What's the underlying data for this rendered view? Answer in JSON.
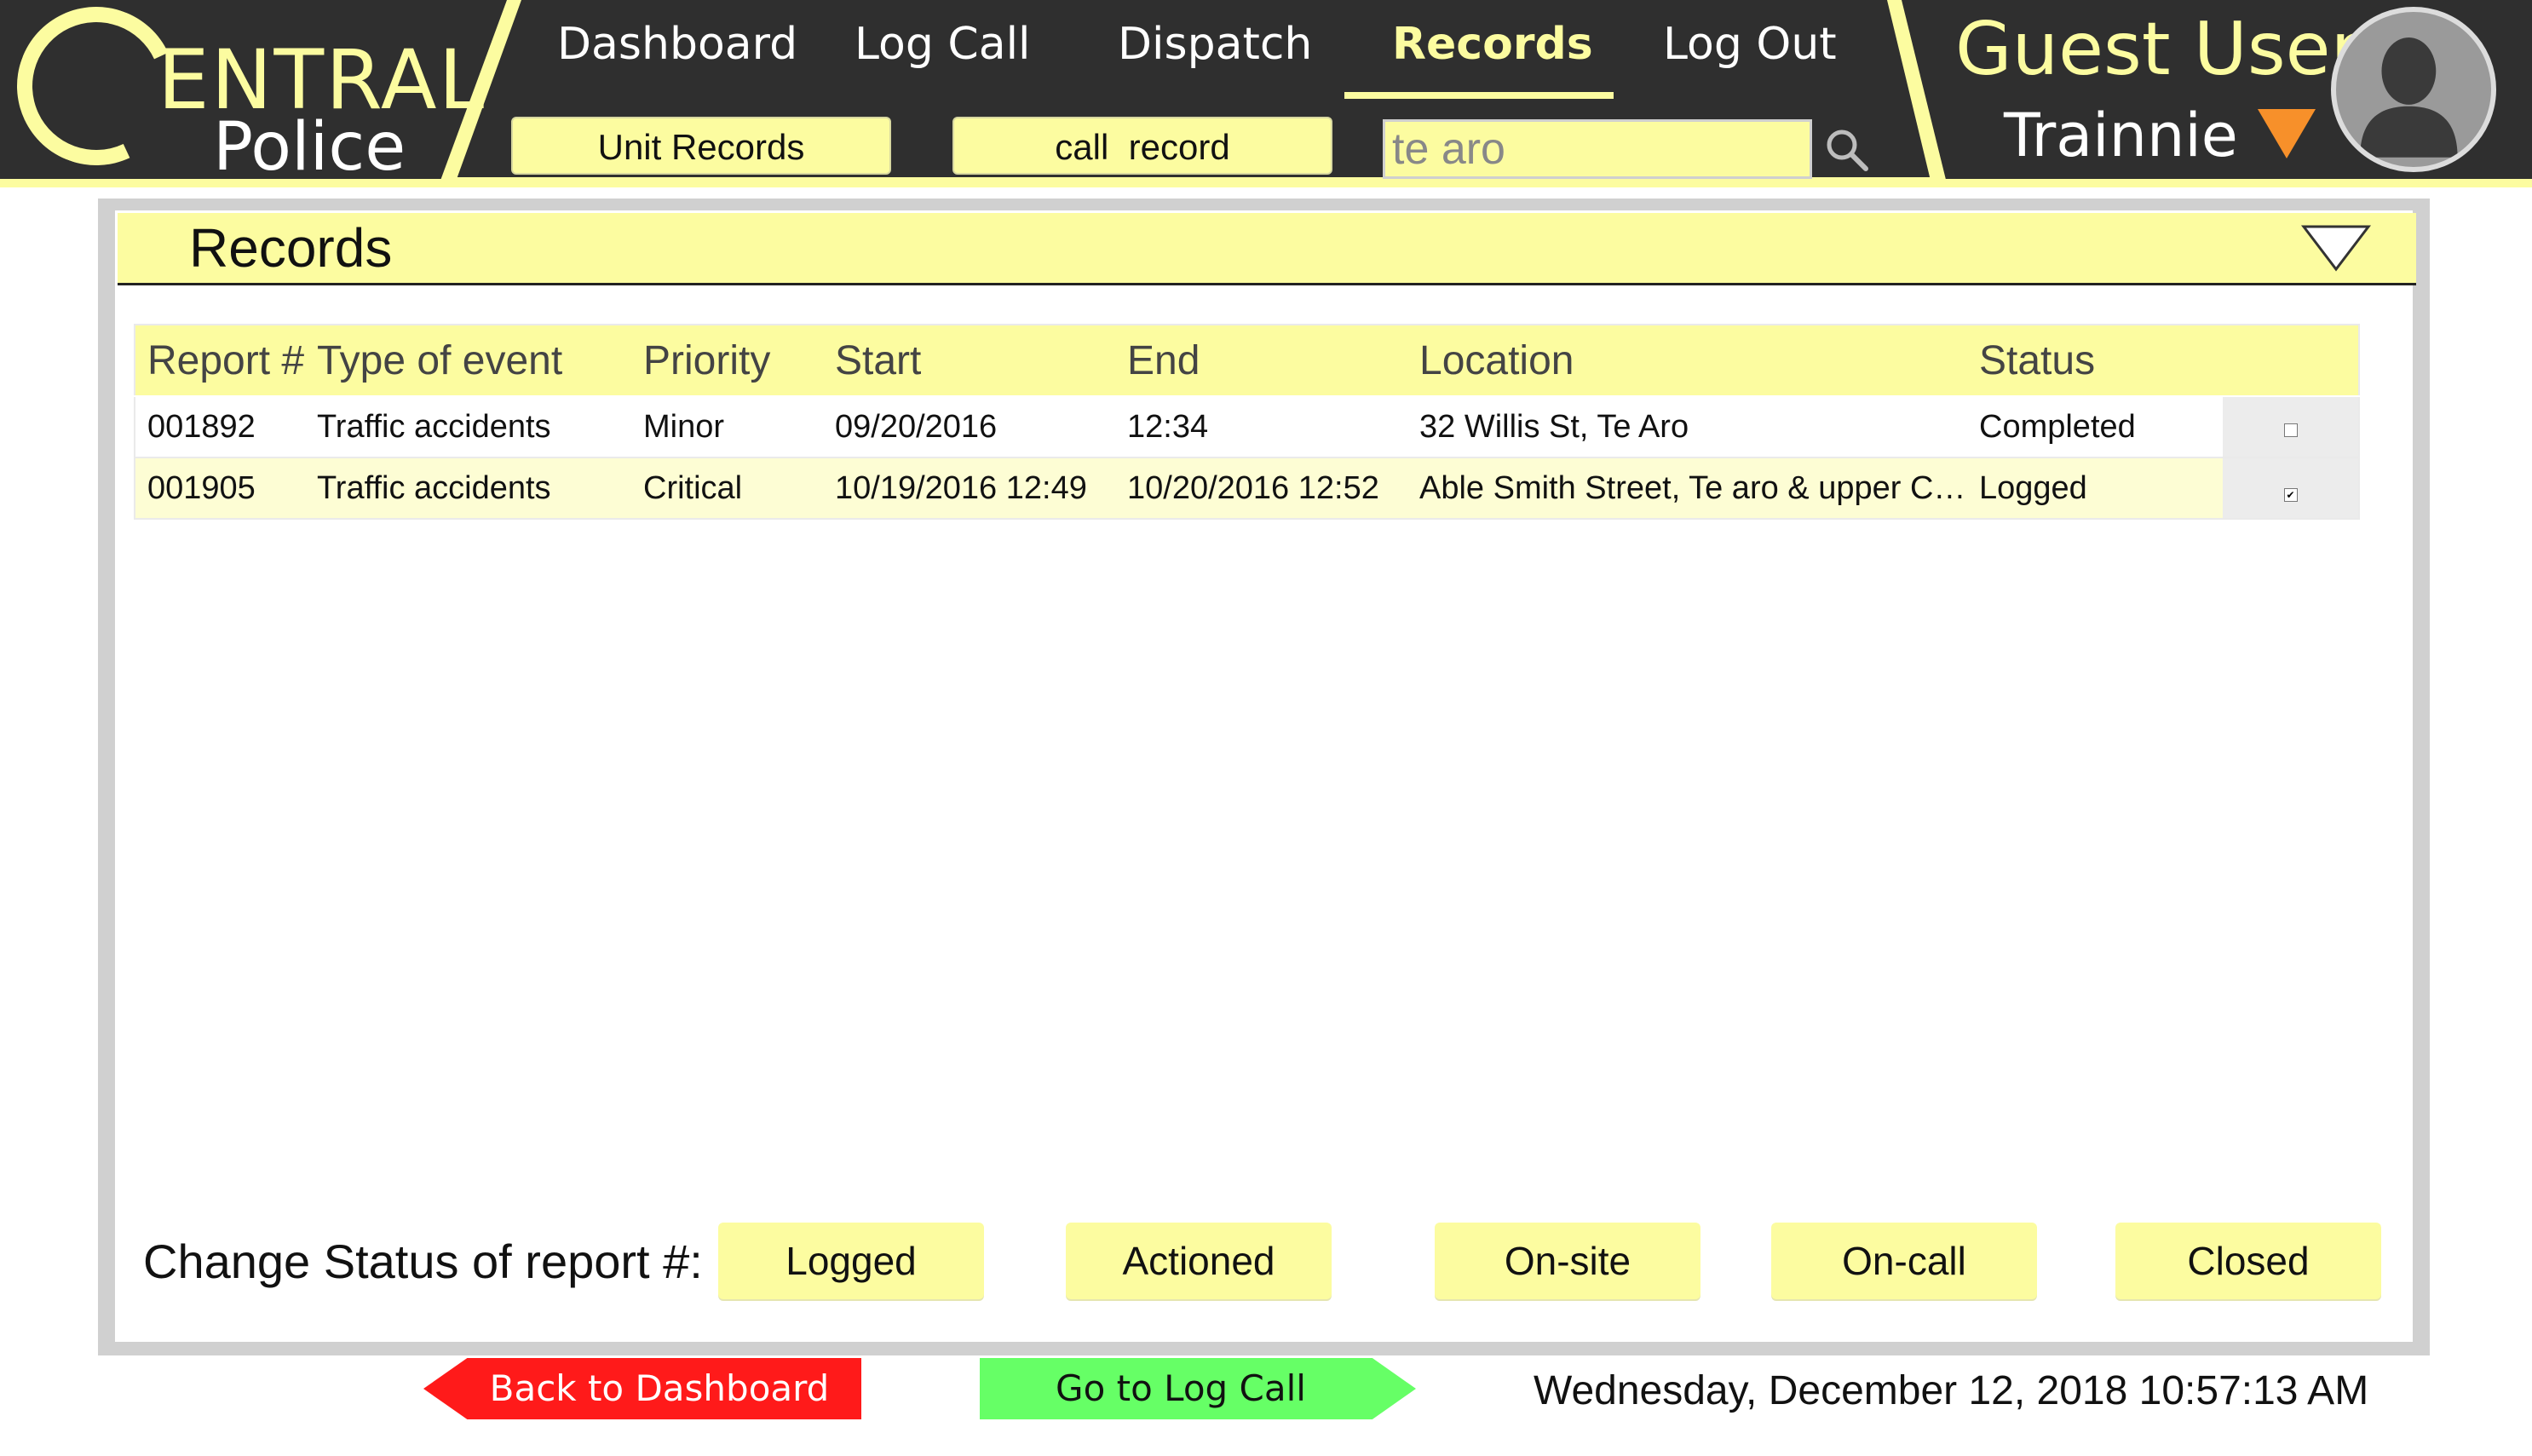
{
  "branding": {
    "logo_text": "ENTRAL",
    "logo_subtitle": "Police",
    "full_name": "Central Police"
  },
  "nav": {
    "items": [
      "Dashboard",
      "Log Call",
      "Dispatch",
      "Records",
      "Log Out"
    ],
    "active": "Records"
  },
  "subnav": {
    "unit_records": "Unit Records",
    "call_record": "call  record",
    "search_value": "te aro",
    "search_icon": "search-icon"
  },
  "user": {
    "name": "Guest User",
    "role": "Trainnie",
    "dropdown_color": "#f7902a"
  },
  "records": {
    "title": "Records",
    "columns": [
      "Report #",
      "Type of event",
      "Priority",
      "Start",
      "End",
      "Location",
      "Status"
    ],
    "rows": [
      {
        "report": "001892",
        "type": "Traffic accidents",
        "priority": "Minor",
        "start": "09/20/2016",
        "end": "12:34",
        "location": "32 Willis St, Te Aro",
        "status": "Completed",
        "checked": false
      },
      {
        "report": "001905",
        "type": "Traffic accidents",
        "priority": "Critical",
        "start": "10/19/2016 12:49",
        "end": "10/20/2016 12:52",
        "location": "Able Smith Street, Te aro & upper C…",
        "status": "Logged",
        "checked": true
      }
    ]
  },
  "status_change": {
    "label": "Change Status of report #:",
    "buttons": [
      "Logged",
      "Actioned",
      "On-site",
      "On-call",
      "Closed"
    ]
  },
  "footer": {
    "back_label": "Back to Dashboard",
    "go_label": "Go to Log Call",
    "datetime": "Wednesday, December 12, 2018 10:57:13 AM"
  },
  "colors": {
    "accent_yellow": "#fcfca0",
    "header_dark": "#2f2f2f",
    "back_red": "#ff1a1a",
    "go_green": "#66ff66"
  }
}
